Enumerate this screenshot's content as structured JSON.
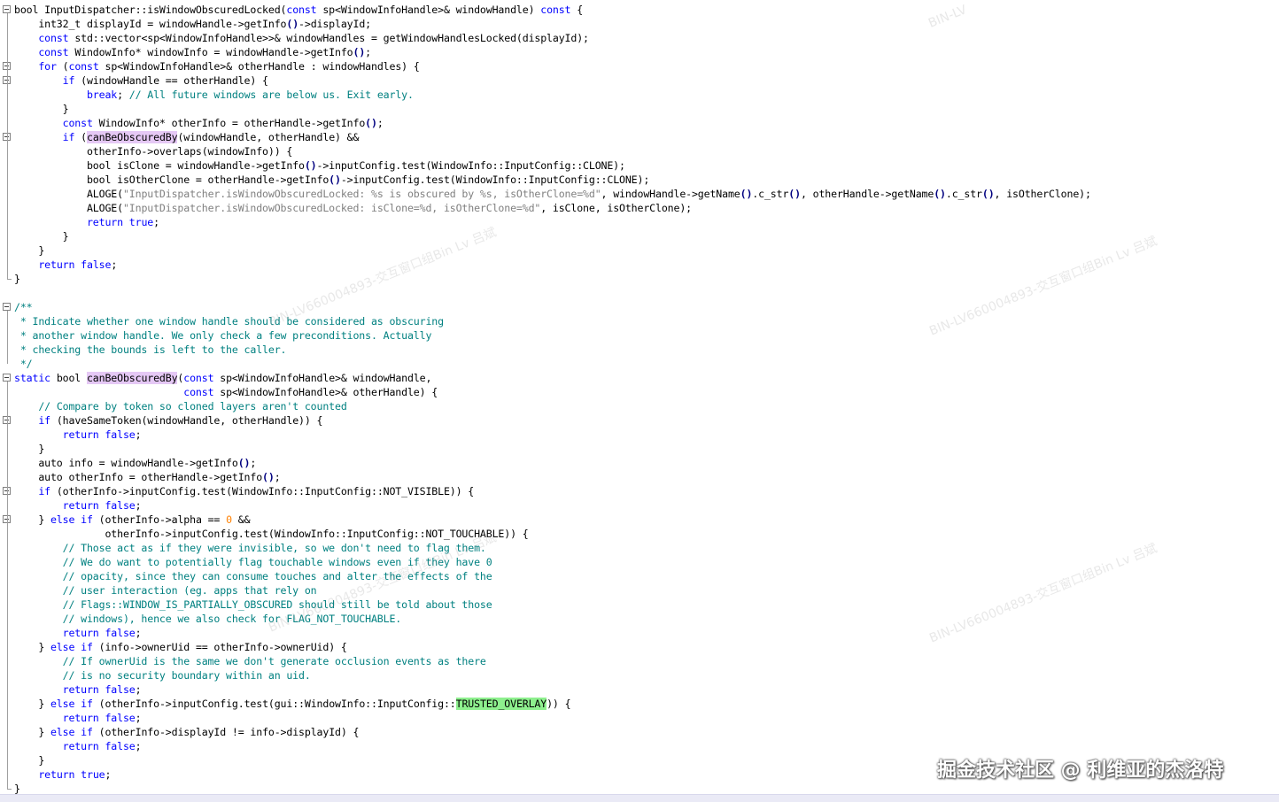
{
  "editor": {
    "lines": [
      [
        [
          "bool InputDispatcher::isWindowObscuredLocked(",
          ""
        ],
        [
          "const",
          "kw"
        ],
        [
          " sp<WindowInfoHandle>& windowHandle) ",
          ""
        ],
        [
          "const",
          "kw"
        ],
        [
          " {",
          ""
        ]
      ],
      [
        [
          "    int32_t displayId = windowHandle->getInfo",
          ""
        ],
        [
          "()",
          "op"
        ],
        [
          "->displayId;",
          ""
        ]
      ],
      [
        [
          "    ",
          ""
        ],
        [
          "const",
          "kw"
        ],
        [
          " std::vector<sp<WindowInfoHandle>>& windowHandles = getWindowHandlesLocked(displayId);",
          ""
        ]
      ],
      [
        [
          "    ",
          ""
        ],
        [
          "const",
          "kw"
        ],
        [
          " WindowInfo* windowInfo = windowHandle->getInfo",
          ""
        ],
        [
          "()",
          "op"
        ],
        [
          ";",
          ""
        ]
      ],
      [
        [
          "    ",
          ""
        ],
        [
          "for",
          "kw"
        ],
        [
          " (",
          ""
        ],
        [
          "const",
          "kw"
        ],
        [
          " sp<WindowInfoHandle>& otherHandle : windowHandles) {",
          ""
        ]
      ],
      [
        [
          "        ",
          ""
        ],
        [
          "if",
          "kw"
        ],
        [
          " (windowHandle == otherHandle) {",
          ""
        ]
      ],
      [
        [
          "            ",
          ""
        ],
        [
          "break",
          "kw"
        ],
        [
          "; ",
          ""
        ],
        [
          "// All future windows are below us. Exit early.",
          "cm"
        ]
      ],
      [
        [
          "        }",
          ""
        ]
      ],
      [
        [
          "        ",
          ""
        ],
        [
          "const",
          "kw"
        ],
        [
          " WindowInfo* otherInfo = otherHandle->getInfo",
          ""
        ],
        [
          "()",
          "op"
        ],
        [
          ";",
          ""
        ]
      ],
      [
        [
          "        ",
          ""
        ],
        [
          "if",
          "kw"
        ],
        [
          " (",
          ""
        ],
        [
          "canBeObscuredBy",
          "hl"
        ],
        [
          "(windowHandle, otherHandle) &&",
          ""
        ]
      ],
      [
        [
          "            otherInfo->overlaps(windowInfo)) {",
          ""
        ]
      ],
      [
        [
          "            bool isClone = windowHandle->getInfo",
          ""
        ],
        [
          "()",
          "op"
        ],
        [
          "->inputConfig.test(WindowInfo::InputConfig::CLONE);",
          ""
        ]
      ],
      [
        [
          "            bool isOtherClone = otherHandle->getInfo",
          ""
        ],
        [
          "()",
          "op"
        ],
        [
          "->inputConfig.test(WindowInfo::InputConfig::CLONE);",
          ""
        ]
      ],
      [
        [
          "            ALOGE(",
          ""
        ],
        [
          "\"InputDispatcher.isWindowObscuredLocked: %s is obscured by %s, isOtherClone=%d\"",
          "st"
        ],
        [
          ", windowHandle->getName",
          ""
        ],
        [
          "()",
          "op"
        ],
        [
          ".c_str",
          ""
        ],
        [
          "()",
          "op"
        ],
        [
          ", otherHandle->getName",
          ""
        ],
        [
          "()",
          "op"
        ],
        [
          ".c_str",
          ""
        ],
        [
          "()",
          "op"
        ],
        [
          ", isOtherClone);",
          ""
        ]
      ],
      [
        [
          "            ALOGE(",
          ""
        ],
        [
          "\"InputDispatcher.isWindowObscuredLocked: isClone=%d, isOtherClone=%d\"",
          "st"
        ],
        [
          ", isClone, isOtherClone);",
          ""
        ]
      ],
      [
        [
          "            ",
          ""
        ],
        [
          "return",
          "kw"
        ],
        [
          " ",
          ""
        ],
        [
          "true",
          "kw"
        ],
        [
          ";",
          ""
        ]
      ],
      [
        [
          "        }",
          ""
        ]
      ],
      [
        [
          "    }",
          ""
        ]
      ],
      [
        [
          "    ",
          ""
        ],
        [
          "return",
          "kw"
        ],
        [
          " ",
          ""
        ],
        [
          "false",
          "kw"
        ],
        [
          ";",
          ""
        ]
      ],
      [
        [
          "}",
          ""
        ]
      ],
      [
        [
          "",
          ""
        ]
      ],
      [
        [
          "/**",
          "cm"
        ]
      ],
      [
        [
          " * Indicate whether one window handle should be considered as obscuring",
          "cm"
        ]
      ],
      [
        [
          " * another window handle. We only check a few preconditions. Actually",
          "cm"
        ]
      ],
      [
        [
          " * checking the bounds is left to the caller.",
          "cm"
        ]
      ],
      [
        [
          " */",
          "cm"
        ]
      ],
      [
        [
          "static",
          "kw"
        ],
        [
          " bool ",
          ""
        ],
        [
          "canBeObscuredBy",
          "hl"
        ],
        [
          "(",
          ""
        ],
        [
          "const",
          "kw"
        ],
        [
          " sp<WindowInfoHandle>& windowHandle,",
          ""
        ]
      ],
      [
        [
          "                            ",
          ""
        ],
        [
          "const",
          "kw"
        ],
        [
          " sp<WindowInfoHandle>& otherHandle) {",
          ""
        ]
      ],
      [
        [
          "    ",
          ""
        ],
        [
          "// Compare by token so cloned layers aren't counted",
          "cm"
        ]
      ],
      [
        [
          "    ",
          ""
        ],
        [
          "if",
          "kw"
        ],
        [
          " (haveSameToken(windowHandle, otherHandle)) {",
          ""
        ]
      ],
      [
        [
          "        ",
          ""
        ],
        [
          "return",
          "kw"
        ],
        [
          " ",
          ""
        ],
        [
          "false",
          "kw"
        ],
        [
          ";",
          ""
        ]
      ],
      [
        [
          "    }",
          ""
        ]
      ],
      [
        [
          "    auto info = windowHandle->getInfo",
          ""
        ],
        [
          "()",
          "op"
        ],
        [
          ";",
          ""
        ]
      ],
      [
        [
          "    auto otherInfo = otherHandle->getInfo",
          ""
        ],
        [
          "()",
          "op"
        ],
        [
          ";",
          ""
        ]
      ],
      [
        [
          "    ",
          ""
        ],
        [
          "if",
          "kw"
        ],
        [
          " (otherInfo->inputConfig.test(WindowInfo::InputConfig::NOT_VISIBLE)) {",
          ""
        ]
      ],
      [
        [
          "        ",
          ""
        ],
        [
          "return",
          "kw"
        ],
        [
          " ",
          ""
        ],
        [
          "false",
          "kw"
        ],
        [
          ";",
          ""
        ]
      ],
      [
        [
          "    } ",
          ""
        ],
        [
          "else",
          "kw"
        ],
        [
          " ",
          ""
        ],
        [
          "if",
          "kw"
        ],
        [
          " (otherInfo->alpha == ",
          ""
        ],
        [
          "0",
          "nm"
        ],
        [
          " &&",
          ""
        ]
      ],
      [
        [
          "               otherInfo->inputConfig.test(WindowInfo::InputConfig::NOT_TOUCHABLE)) {",
          ""
        ]
      ],
      [
        [
          "        ",
          ""
        ],
        [
          "// Those act as if they were invisible, so we don't need to flag them.",
          "cm"
        ]
      ],
      [
        [
          "        ",
          ""
        ],
        [
          "// We do want to potentially flag touchable windows even if they have 0",
          "cm"
        ]
      ],
      [
        [
          "        ",
          ""
        ],
        [
          "// opacity, since they can consume touches and alter the effects of the",
          "cm"
        ]
      ],
      [
        [
          "        ",
          ""
        ],
        [
          "// user interaction (eg. apps that rely on",
          "cm"
        ]
      ],
      [
        [
          "        ",
          ""
        ],
        [
          "// Flags::WINDOW_IS_PARTIALLY_OBSCURED should still be told about those",
          "cm"
        ]
      ],
      [
        [
          "        ",
          ""
        ],
        [
          "// windows), hence we also check for FLAG_NOT_TOUCHABLE.",
          "cm"
        ]
      ],
      [
        [
          "        ",
          ""
        ],
        [
          "return",
          "kw"
        ],
        [
          " ",
          ""
        ],
        [
          "false",
          "kw"
        ],
        [
          ";",
          ""
        ]
      ],
      [
        [
          "    } ",
          ""
        ],
        [
          "else",
          "kw"
        ],
        [
          " ",
          ""
        ],
        [
          "if",
          "kw"
        ],
        [
          " (info->ownerUid == otherInfo->ownerUid) {",
          ""
        ]
      ],
      [
        [
          "        ",
          ""
        ],
        [
          "// If ownerUid is the same we don't generate occlusion events as there",
          "cm"
        ]
      ],
      [
        [
          "        ",
          ""
        ],
        [
          "// is no security boundary within an uid.",
          "cm"
        ]
      ],
      [
        [
          "        ",
          ""
        ],
        [
          "return",
          "kw"
        ],
        [
          " ",
          ""
        ],
        [
          "false",
          "kw"
        ],
        [
          ";",
          ""
        ]
      ],
      [
        [
          "    } ",
          ""
        ],
        [
          "else",
          "kw"
        ],
        [
          " ",
          ""
        ],
        [
          "if",
          "kw"
        ],
        [
          " (otherInfo->inputConfig.test(gui::WindowInfo::InputConfig::",
          ""
        ],
        [
          "TRUSTED_OVERLAY",
          "hlg"
        ],
        [
          ")) {",
          ""
        ]
      ],
      [
        [
          "        ",
          ""
        ],
        [
          "return",
          "kw"
        ],
        [
          " ",
          ""
        ],
        [
          "false",
          "kw"
        ],
        [
          ";",
          ""
        ]
      ],
      [
        [
          "    } ",
          ""
        ],
        [
          "else",
          "kw"
        ],
        [
          " ",
          ""
        ],
        [
          "if",
          "kw"
        ],
        [
          " (otherInfo->displayId != info->displayId) {",
          ""
        ]
      ],
      [
        [
          "        ",
          ""
        ],
        [
          "return",
          "kw"
        ],
        [
          " ",
          ""
        ],
        [
          "false",
          "kw"
        ],
        [
          ";",
          ""
        ]
      ],
      [
        [
          "    }",
          ""
        ]
      ],
      [
        [
          "    ",
          ""
        ],
        [
          "return",
          "kw"
        ],
        [
          " ",
          ""
        ],
        [
          "true",
          "kw"
        ],
        [
          ";",
          ""
        ]
      ],
      [
        [
          "}",
          ""
        ]
      ]
    ]
  },
  "watermarks": {
    "user_text": "BIN-LV660004893-交互窗口组Bin Lv 吕斌",
    "corner_fragment": "BIN-LV"
  },
  "site_mark": "掘金技术社区 @ 利维亚的杰洛特"
}
